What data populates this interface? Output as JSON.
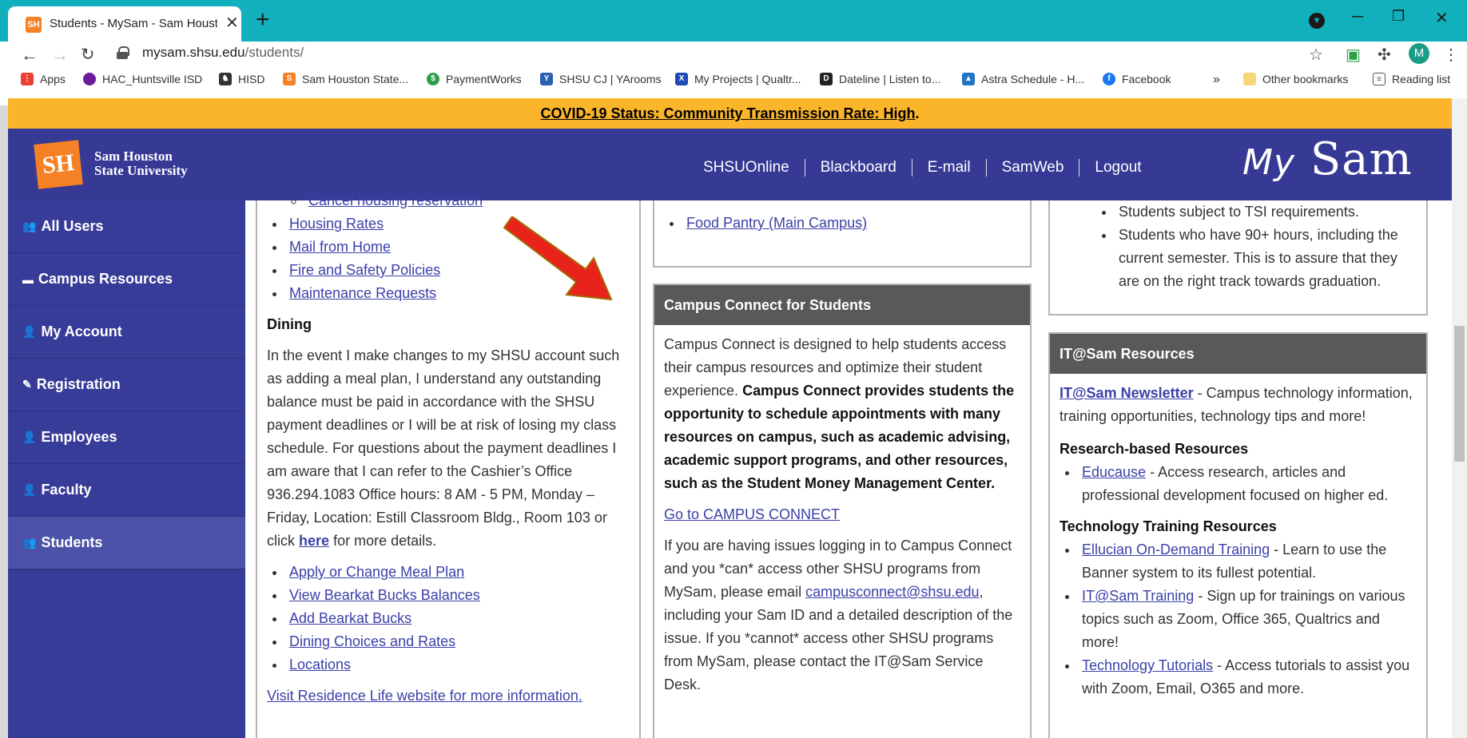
{
  "browser": {
    "tab": {
      "favicon": "SH",
      "title": "Students - MySam - Sam Houston",
      "close": "✕"
    },
    "new_tab": "+",
    "url_host": "mysam.shsu.edu",
    "url_path": "/students/",
    "avatar": "M",
    "bookmarks": [
      {
        "label": "Apps",
        "icon": "apps-grid-icon",
        "color": "#e94235"
      },
      {
        "label": "HAC_Huntsville ISD",
        "icon": "globe-icon",
        "color": "#6a1b9a"
      },
      {
        "label": "HISD",
        "icon": "horse-icon",
        "color": "#333333"
      },
      {
        "label": "Sam Houston State...",
        "icon": "shsu-icon",
        "color": "#f58025"
      },
      {
        "label": "PaymentWorks",
        "icon": "paymentworks-icon",
        "color": "#2e9e4a"
      },
      {
        "label": "SHSU CJ | YArooms",
        "icon": "yarooms-icon",
        "color": "#2b5fb0"
      },
      {
        "label": "My Projects | Qualtr...",
        "icon": "qualtrics-icon",
        "color": "#1d4cb5"
      },
      {
        "label": "Dateline | Listen to...",
        "icon": "dateline-icon",
        "color": "#222222"
      },
      {
        "label": "Astra Schedule - H...",
        "icon": "astra-icon",
        "color": "#2173c4"
      },
      {
        "label": "Facebook",
        "icon": "facebook-icon",
        "color": "#1877f2"
      }
    ],
    "more_bookmarks": "»",
    "other_bookmarks": "Other bookmarks",
    "reading_list": "Reading list"
  },
  "covid_banner": {
    "text": "COVID-19 Status: Community Transmission Rate: High",
    "suffix": "."
  },
  "header": {
    "logo_mark": "SH",
    "logo_line1": "Sam Houston",
    "logo_line2": "State University",
    "nav": [
      "SHSUOnline",
      "Blackboard",
      "E-mail",
      "SamWeb",
      "Logout"
    ],
    "brand_my": "My",
    "brand_sam": "Sam"
  },
  "sidebar": [
    {
      "label": "All Users",
      "icon": "users-icon",
      "glyph": "👥"
    },
    {
      "label": "Campus Resources",
      "icon": "folder-icon",
      "glyph": "▬"
    },
    {
      "label": "My Account",
      "icon": "user-icon",
      "glyph": "👤"
    },
    {
      "label": "Registration",
      "icon": "edit-icon",
      "glyph": "✎"
    },
    {
      "label": "Employees",
      "icon": "employee-icon",
      "glyph": "👤"
    },
    {
      "label": "Faculty",
      "icon": "faculty-icon",
      "glyph": "👤"
    },
    {
      "label": "Students",
      "icon": "students-icon",
      "glyph": "👥",
      "active": true
    }
  ],
  "col1": {
    "cut_link": "Cancel housing reservation",
    "housing_links": [
      "Housing Rates",
      "Mail from Home",
      "Fire and Safety Policies",
      "Maintenance Requests"
    ],
    "dining_heading": "Dining",
    "dining_text": "In the event I make changes to my SHSU account such as adding a meal plan, I understand any outstanding balance must be paid in accordance with the SHSU payment deadlines or I will be at risk of losing my class schedule. For questions about the payment deadlines I am aware that I can refer to the Cashier’s Office 936.294.1083 Office hours: 8 AM - 5 PM, Monday – Friday, Location: Estill Classroom Bldg., Room 103 or click",
    "dining_here": "here",
    "dining_tail": "for more details.",
    "dining_links": [
      "Apply or Change Meal Plan",
      "View Bearkat Bucks Balances",
      "Add Bearkat Bucks",
      "Dining Choices and Rates",
      "Locations"
    ],
    "reslife": "Visit Residence Life website for more information."
  },
  "col2": {
    "food_pantry": "Food Pantry (Main Campus)",
    "box_title": "Campus Connect for Students",
    "intro": "Campus Connect is designed to help students access their campus resources and optimize their student experience.",
    "bold": "Campus Connect provides students the opportunity to schedule appointments with many resources on campus, such as academic advising, academic support programs, and other resources, such as the Student Money Management Center.",
    "goto": "Go to CAMPUS CONNECT",
    "issue1": "If you are having issues logging in to Campus Connect and you *can* access other SHSU programs from MySam, please email",
    "email": "campusconnect@shsu.edu",
    "issue2": ", including your Sam ID and a detailed description of the issue. If you *cannot* access other SHSU programs from MySam, please contact the IT@Sam Service Desk."
  },
  "col3": {
    "tsi_items": [
      "Students subject to TSI requirements.",
      "Students who have 90+ hours, including the current semester. This is to assure that they are on the right track towards graduation."
    ],
    "box_title": "IT@Sam Resources",
    "newsletter": "IT@Sam Newsletter",
    "newsletter_desc": " - Campus technology information, training opportunities, technology tips and more!",
    "research_heading": "Research-based Resources",
    "educause": "Educause",
    "educause_desc": " - Access research, articles and professional development focused on higher ed.",
    "training_heading": "Technology Training Resources",
    "training": [
      {
        "link": "Ellucian On-Demand Training",
        "desc": " - Learn to use the Banner system to its fullest potential."
      },
      {
        "link": "IT@Sam Training",
        "desc": " - Sign up for trainings on various topics such as Zoom, Office 365, Qualtrics and more!"
      },
      {
        "link": "Technology Tutorials",
        "desc": " - Access tutorials to assist you with Zoom, Email, O365 and more."
      }
    ]
  },
  "colors": {
    "header": "#363a94",
    "banner": "#fbb52a",
    "annotation_arrow": "#e8231c"
  }
}
